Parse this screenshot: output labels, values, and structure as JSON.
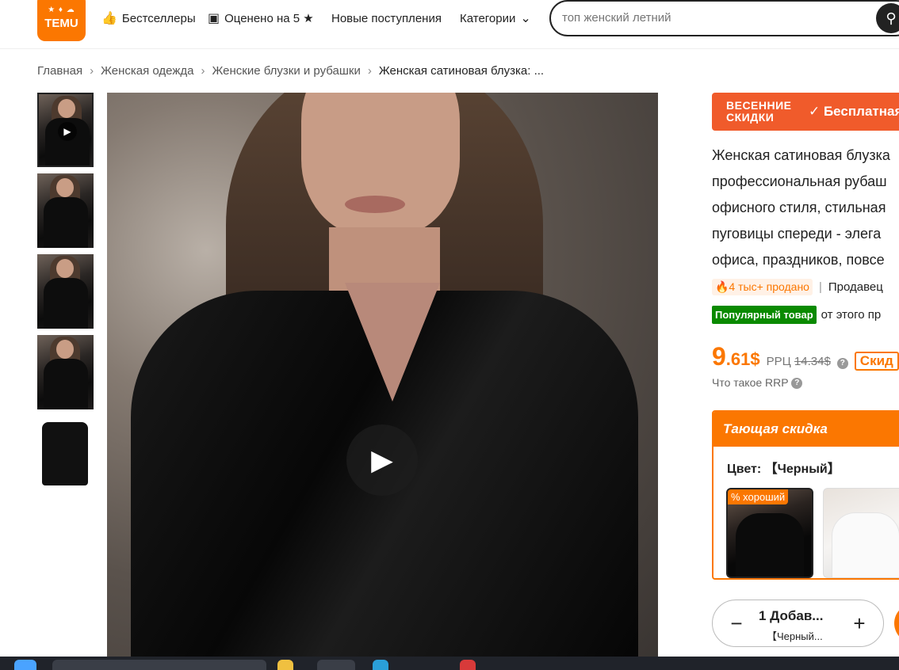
{
  "header": {
    "logo_text": "TEMU",
    "logo_mini": "ᐦᐦᐦ",
    "nav": [
      {
        "label": "Бестселлеры",
        "icon": "thumbs-up-icon"
      },
      {
        "label": "Оценено на 5 ★",
        "icon": "star-badge-icon"
      },
      {
        "label": "Новые поступления"
      },
      {
        "label": "Категории",
        "icon": "chevron-down-icon"
      }
    ],
    "search_placeholder": "топ женский летний",
    "search_icon": "search-icon"
  },
  "breadcrumb": [
    "Главная",
    "Женская одежда",
    "Женские блузки и рубашки",
    "Женская сатиновая блузка: ..."
  ],
  "banner": {
    "promo": "ВЕСЕННИЕ СКИДКИ",
    "shipping": "✓ Бесплатная"
  },
  "product": {
    "title_lines": [
      "Женская сатиновая блузка",
      "профессиональная рубаш",
      "офисного стиля, стильная",
      "пуговицы спереди - элега",
      "офиса, праздников, повсе"
    ],
    "sold": "🔥4 тыс+ продано",
    "seller": "Продавец",
    "popular_badge": "Популярный товар",
    "popular_note": "от этого пр",
    "price_whole": "9",
    "price_fraction": ".61$",
    "rrp_label": "РРЦ",
    "rrp_value": "14.34$",
    "discount_tag": "Скид",
    "rrp_link": "Что такое RRP"
  },
  "offer": {
    "header": "Тающая скидка",
    "color_label": "Цвет: 【Черный】",
    "swatch_badge": "% хороший",
    "swatches": [
      "Черный",
      "Белый"
    ]
  },
  "cart": {
    "qty_add": "1 Добав...",
    "selected": "【Черный..."
  },
  "colors": {
    "accent": "#fb7701",
    "banner": "#f05b2b",
    "popular": "#0a8a00"
  }
}
